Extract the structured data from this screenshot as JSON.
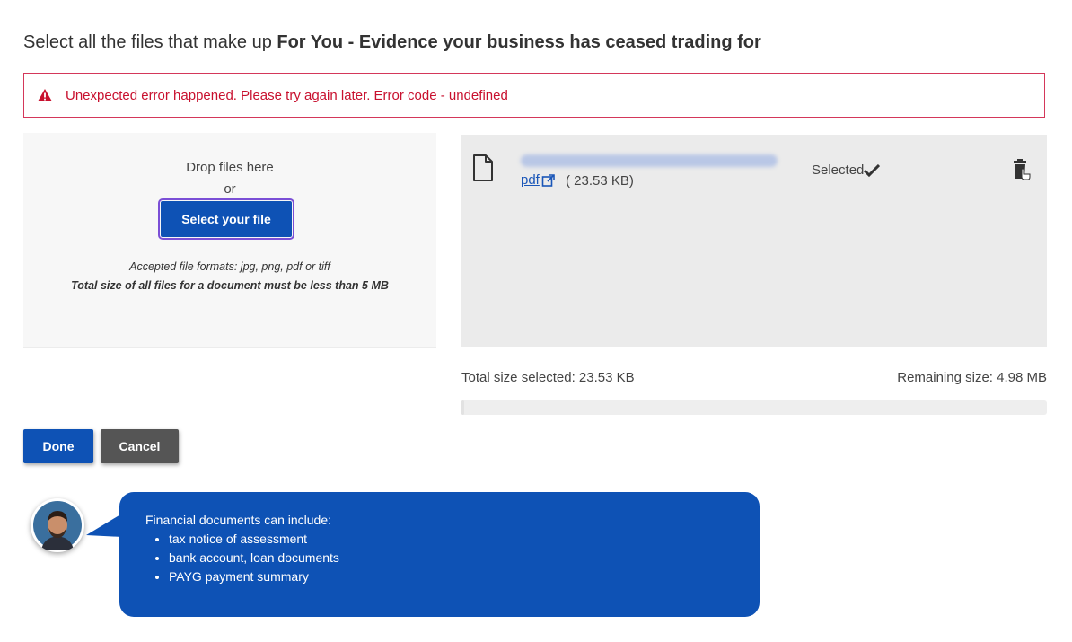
{
  "heading": {
    "prefix": "Select all the files that make up ",
    "bold": "For You - Evidence your business has ceased trading for"
  },
  "error": {
    "message": "Unexpected error happened. Please try again later. Error code - undefined",
    "color": "#c8102e"
  },
  "dropzone": {
    "drop_text": "Drop files here",
    "or_text": "or",
    "select_button": "Select your file",
    "formats_text": "Accepted file formats: jpg, png, pdf or tiff",
    "limit_text": "Total size of all files for a document must be less than 5 MB"
  },
  "file": {
    "link_text": "pdf",
    "size_text": "( 23.53 KB)",
    "status": "Selected",
    "icon": "file-icon"
  },
  "summary": {
    "total_selected": "Total size selected: 23.53 KB",
    "remaining": "Remaining size: 4.98 MB",
    "used_fraction": 0.0046
  },
  "actions": {
    "done": "Done",
    "cancel": "Cancel"
  },
  "tip": {
    "title": "Financial documents can include:",
    "items": [
      "tax notice of assessment",
      "bank account, loan documents",
      "PAYG payment summary"
    ]
  },
  "colors": {
    "primary": "#0e52b5",
    "cancel": "#555555",
    "error": "#c8102e",
    "panel": "#ebebeb"
  }
}
